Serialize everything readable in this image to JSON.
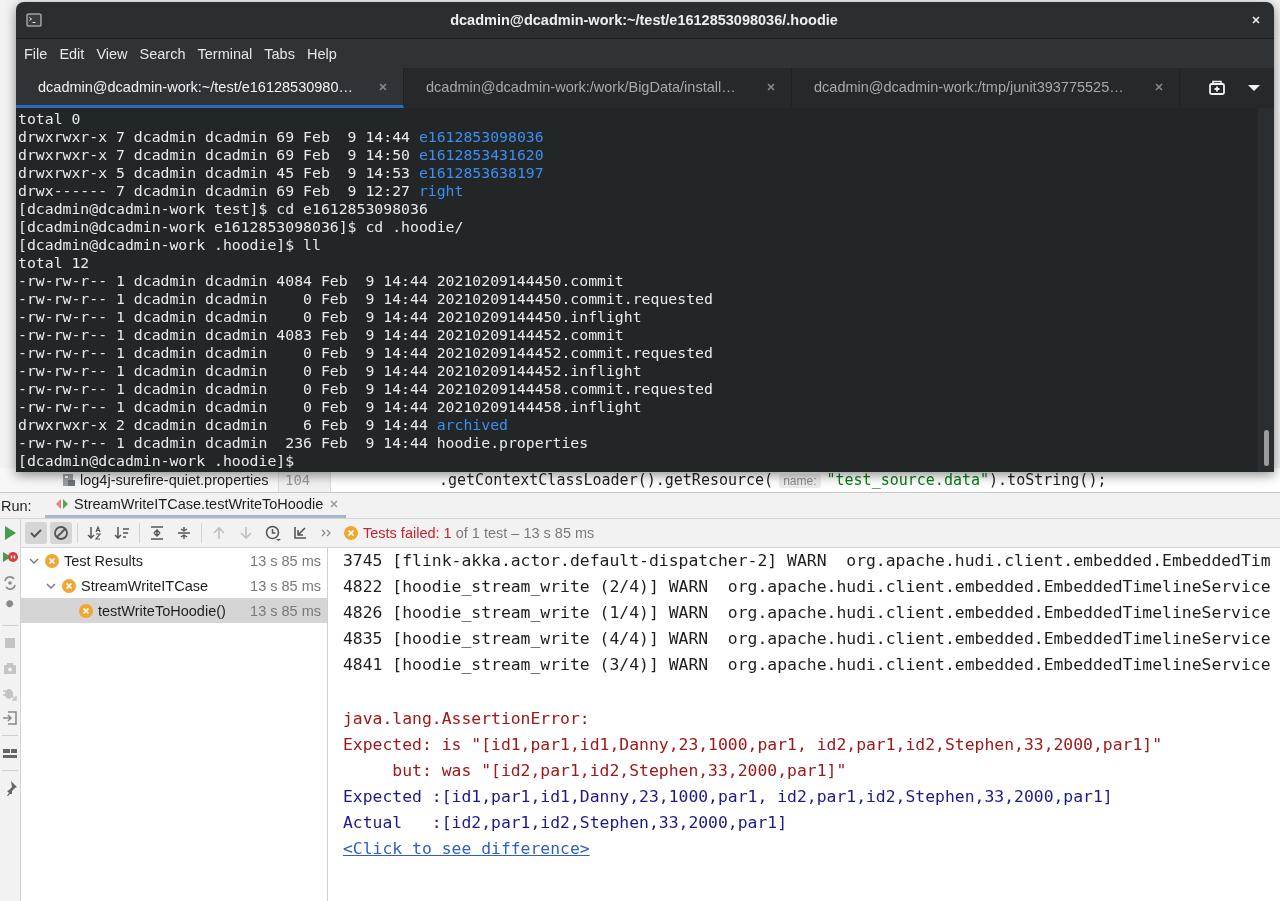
{
  "terminal": {
    "title": "dcadmin@dcadmin-work:~/test/e1612853098036/.hoodie",
    "menu": [
      "File",
      "Edit",
      "View",
      "Search",
      "Terminal",
      "Tabs",
      "Help"
    ],
    "tabs": [
      {
        "label": "dcadmin@dcadmin-work:~/test/e16128530980…",
        "selected": true
      },
      {
        "label": "dcadmin@dcadmin-work:/work/BigData/install…",
        "selected": false
      },
      {
        "label": "dcadmin@dcadmin-work:/tmp/junit393775525…",
        "selected": false
      }
    ],
    "lines": [
      {
        "kind": "plain",
        "text": "total 0"
      },
      {
        "kind": "dir",
        "text": "drwxrwxr-x 7 dcadmin dcadmin 69 Feb  9 14:44 ",
        "name": "e1612853098036"
      },
      {
        "kind": "dir",
        "text": "drwxrwxr-x 7 dcadmin dcadmin 69 Feb  9 14:50 ",
        "name": "e1612853431620"
      },
      {
        "kind": "dir",
        "text": "drwxrwxr-x 5 dcadmin dcadmin 45 Feb  9 14:53 ",
        "name": "e1612853638197"
      },
      {
        "kind": "dir",
        "text": "drwx------ 7 dcadmin dcadmin 69 Feb  9 12:27 ",
        "name": "right"
      },
      {
        "kind": "plain",
        "text": "[dcadmin@dcadmin-work test]$ cd e1612853098036"
      },
      {
        "kind": "plain",
        "text": "[dcadmin@dcadmin-work e1612853098036]$ cd .hoodie/"
      },
      {
        "kind": "plain",
        "text": "[dcadmin@dcadmin-work .hoodie]$ ll"
      },
      {
        "kind": "plain",
        "text": "total 12"
      },
      {
        "kind": "plain",
        "text": "-rw-rw-r-- 1 dcadmin dcadmin 4084 Feb  9 14:44 20210209144450.commit"
      },
      {
        "kind": "plain",
        "text": "-rw-rw-r-- 1 dcadmin dcadmin    0 Feb  9 14:44 20210209144450.commit.requested"
      },
      {
        "kind": "plain",
        "text": "-rw-rw-r-- 1 dcadmin dcadmin    0 Feb  9 14:44 20210209144450.inflight"
      },
      {
        "kind": "plain",
        "text": "-rw-rw-r-- 1 dcadmin dcadmin 4083 Feb  9 14:44 20210209144452.commit"
      },
      {
        "kind": "plain",
        "text": "-rw-rw-r-- 1 dcadmin dcadmin    0 Feb  9 14:44 20210209144452.commit.requested"
      },
      {
        "kind": "plain",
        "text": "-rw-rw-r-- 1 dcadmin dcadmin    0 Feb  9 14:44 20210209144452.inflight"
      },
      {
        "kind": "plain",
        "text": "-rw-rw-r-- 1 dcadmin dcadmin    0 Feb  9 14:44 20210209144458.commit.requested"
      },
      {
        "kind": "plain",
        "text": "-rw-rw-r-- 1 dcadmin dcadmin    0 Feb  9 14:44 20210209144458.inflight"
      },
      {
        "kind": "dir",
        "text": "drwxrwxr-x 2 dcadmin dcadmin    6 Feb  9 14:44 ",
        "name": "archived"
      },
      {
        "kind": "plain",
        "text": "-rw-rw-r-- 1 dcadmin dcadmin  236 Feb  9 14:44 hoodie.properties"
      },
      {
        "kind": "plain",
        "text": "[dcadmin@dcadmin-work .hoodie]$"
      }
    ]
  },
  "editor_peek": {
    "file": "log4j-surefire-quiet.properties",
    "line_number": "104",
    "code": ".getContextClassLoader().getResource(",
    "hint": "name:",
    "string": "\"test_source.data\"",
    "code_end": ").toString();"
  },
  "run": {
    "label": "Run:",
    "tab": "StreamWriteITCase.testWriteToHoodie",
    "show_passed": true,
    "show_ignored": true,
    "status": {
      "label": "Tests failed: ",
      "count": "1",
      "rest": " of 1 test – 13 s 85 ms"
    },
    "tree": [
      {
        "label": "Test Results",
        "time": "13 s 85 ms",
        "failed": true,
        "expanded": true,
        "selected": false,
        "children": [
          {
            "label": "StreamWriteITCase",
            "time": "13 s 85 ms",
            "failed": true,
            "expanded": true,
            "selected": false,
            "children": [
              {
                "label": "testWriteToHoodie()",
                "time": "13 s 85 ms",
                "failed": true,
                "selected": true
              }
            ]
          }
        ]
      }
    ],
    "console": {
      "log": [
        "3745 [flink-akka.actor.default-dispatcher-2] WARN  org.apache.hudi.client.embedded.EmbeddedTim",
        "4822 [hoodie_stream_write (2/4)] WARN  org.apache.hudi.client.embedded.EmbeddedTimelineService",
        "4826 [hoodie_stream_write (1/4)] WARN  org.apache.hudi.client.embedded.EmbeddedTimelineService",
        "4835 [hoodie_stream_write (4/4)] WARN  org.apache.hudi.client.embedded.EmbeddedTimelineService",
        "4841 [hoodie_stream_write (3/4)] WARN  org.apache.hudi.client.embedded.EmbeddedTimelineService"
      ],
      "error": [
        "java.lang.AssertionError:",
        "Expected: is \"[id1,par1,id1,Danny,23,1000,par1, id2,par1,id2,Stephen,33,2000,par1]\"",
        "     but: was \"[id2,par1,id2,Stephen,33,2000,par1]\""
      ],
      "comparison": [
        "Expected :[id1,par1,id1,Danny,23,1000,par1, id2,par1,id2,Stephen,33,2000,par1]",
        "Actual   :[id2,par1,id2,Stephen,33,2000,par1]"
      ],
      "link": "<Click to see difference>"
    }
  }
}
